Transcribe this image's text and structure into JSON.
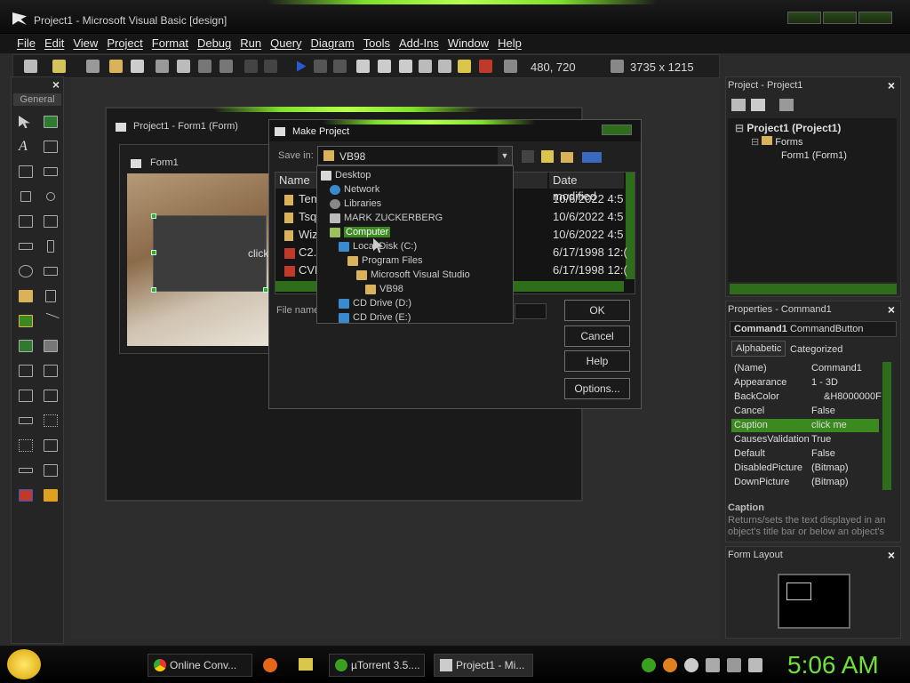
{
  "window": {
    "title": "Project1 - Microsoft Visual Basic [design]"
  },
  "menu": [
    "File",
    "Edit",
    "View",
    "Project",
    "Format",
    "Debug",
    "Run",
    "Query",
    "Diagram",
    "Tools",
    "Add-Ins",
    "Window",
    "Help"
  ],
  "toolbar": {
    "position": "480, 720",
    "size": "3735 x 1215"
  },
  "toolbox": {
    "close": "×",
    "tab": "General"
  },
  "form_designer": {
    "title": "Project1 - Form1 (Form)",
    "form_title": "Form1",
    "button_caption": "click"
  },
  "dialog": {
    "title": "Make Project",
    "save_in_label": "Save in:",
    "save_in_value": "VB98",
    "columns": [
      "Name",
      "Date modified"
    ],
    "files": [
      {
        "name": "Tem",
        "date": "10/6/2022 4:5"
      },
      {
        "name": "Tsql",
        "date": "10/6/2022 4:5"
      },
      {
        "name": "Wiz",
        "date": "10/6/2022 4:5"
      },
      {
        "name": "C2.I",
        "date": "6/17/1998 12:("
      },
      {
        "name": "CVP",
        "date": "6/17/1998 12:("
      }
    ],
    "filename_label": "File name",
    "buttons": {
      "ok": "OK",
      "cancel": "Cancel",
      "help": "Help",
      "options": "Options..."
    }
  },
  "dropdown": [
    "Desktop",
    "Network",
    "Libraries",
    "MARK ZUCKERBERG",
    "Computer",
    "Local Disk (C:)",
    "Program Files",
    "Microsoft Visual Studio",
    "VB98",
    "CD Drive (D:)",
    "CD Drive (E:)"
  ],
  "project": {
    "title": "Project - Project1",
    "tree": [
      "Project1 (Project1)",
      "Forms",
      "Form1 (Form1)"
    ]
  },
  "properties": {
    "title": "Properties - Command1",
    "object": "Command1",
    "object_type": "CommandButton",
    "tabs": [
      "Alphabetic",
      "Categorized"
    ],
    "rows": [
      {
        "name": "(Name)",
        "value": "Command1"
      },
      {
        "name": "Appearance",
        "value": "1 - 3D"
      },
      {
        "name": "BackColor",
        "value": "&H8000000F"
      },
      {
        "name": "Cancel",
        "value": "False"
      },
      {
        "name": "Caption",
        "value": "click me"
      },
      {
        "name": "CausesValidation",
        "value": "True"
      },
      {
        "name": "Default",
        "value": "False"
      },
      {
        "name": "DisabledPicture",
        "value": "(Bitmap)"
      },
      {
        "name": "DownPicture",
        "value": "(Bitmap)"
      }
    ],
    "desc_title": "Caption",
    "desc_text": "Returns/sets the text displayed in an object's title bar or below an object's"
  },
  "form_layout": {
    "title": "Form Layout"
  },
  "taskbar": {
    "tasks": [
      "Online Conv...",
      "µTorrent 3.5....",
      "Project1 - Mi..."
    ],
    "clock": "5:06 AM"
  },
  "colors": {
    "accent": "#6ee23a",
    "selection": "#3a8a20"
  }
}
